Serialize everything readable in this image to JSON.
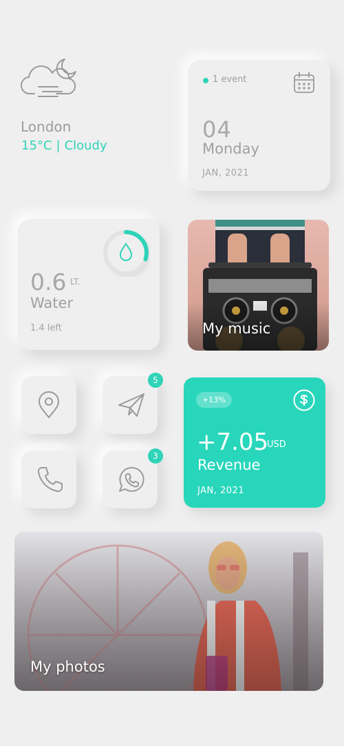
{
  "weather": {
    "city": "London",
    "temperature": "15°C",
    "separator": "|",
    "condition": "Cloudy",
    "icon": "cloud-moon-icon"
  },
  "calendar": {
    "event_count": "1 event",
    "day": "04",
    "weekday": "Monday",
    "month_year": "JAN, 2021",
    "icon": "calendar-icon"
  },
  "water": {
    "amount": "0.6",
    "unit": "LT.",
    "label": "Water",
    "remaining": "1.4 left",
    "progress_fraction": 0.3,
    "icon": "water-drop-icon"
  },
  "music": {
    "title": "My music"
  },
  "shortcuts": [
    {
      "name": "location",
      "icon": "location-pin-icon",
      "badge": ""
    },
    {
      "name": "send",
      "icon": "paper-plane-icon",
      "badge": "5"
    },
    {
      "name": "phone",
      "icon": "phone-icon",
      "badge": ""
    },
    {
      "name": "whatsapp",
      "icon": "whatsapp-icon",
      "badge": "3"
    }
  ],
  "revenue": {
    "change": "+13%",
    "value": "+7.05",
    "currency": "USD",
    "label": "Revenue",
    "date": "JAN, 2021",
    "icon": "dollar-circle-icon"
  },
  "photos": {
    "title": "My photos"
  },
  "colors": {
    "accent": "#2fd3b8",
    "background": "#efefef",
    "text_muted": "#9c9c9c"
  }
}
